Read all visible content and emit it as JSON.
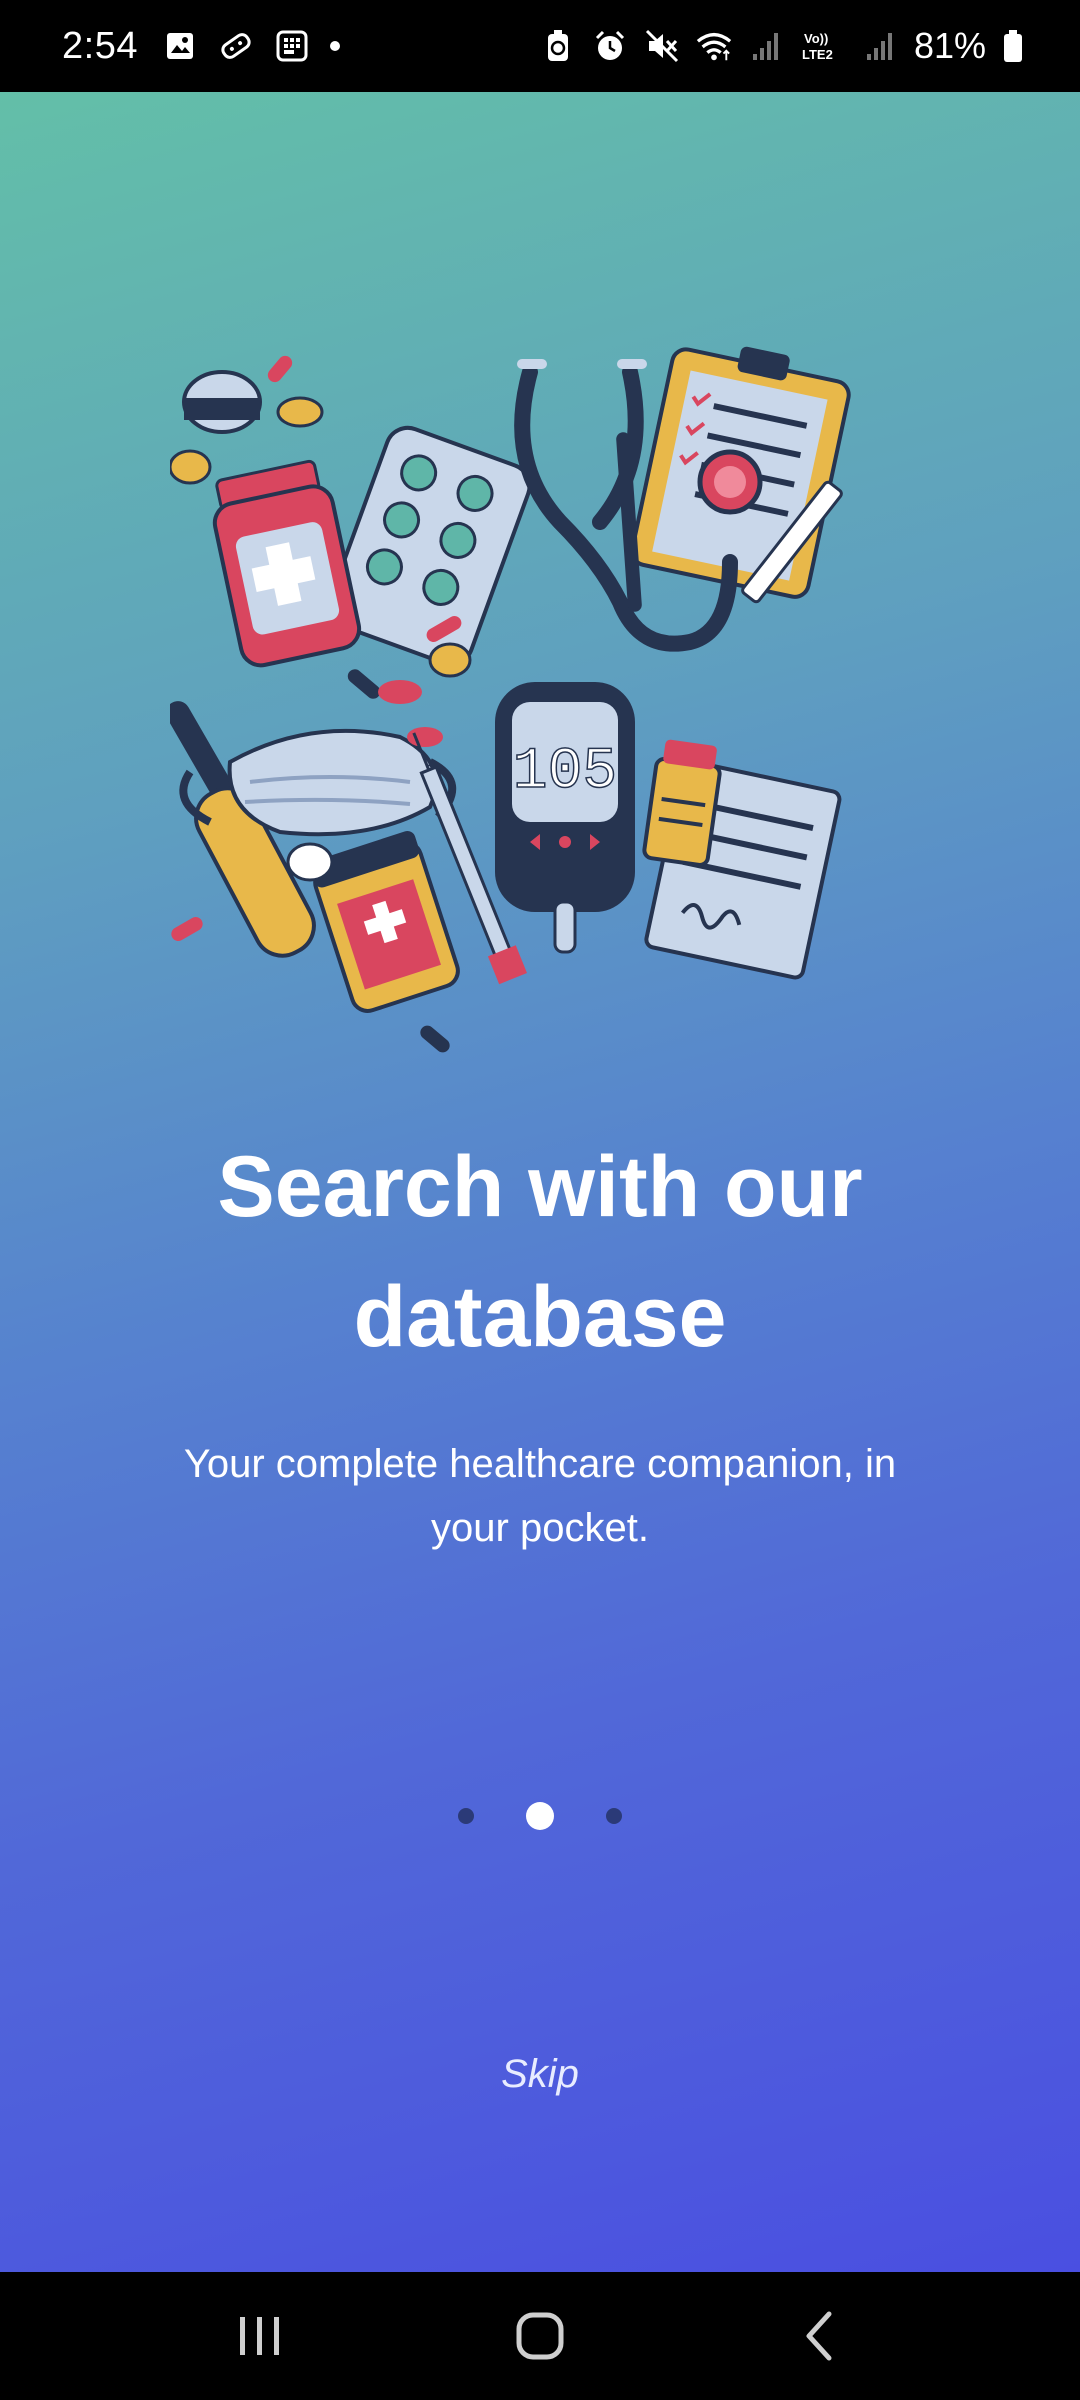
{
  "status_bar": {
    "time": "2:54",
    "battery": "81%",
    "left_icons": [
      "gallery-icon",
      "game-icon",
      "calculator-icon",
      "notification-dot"
    ],
    "right_icons": [
      "battery-saver-icon",
      "alarm-icon",
      "mute-icon",
      "wifi-icon",
      "signal-icon",
      "volte-icon",
      "signal-icon-2",
      "battery-icon"
    ]
  },
  "onboarding": {
    "title": "Search with our database",
    "subtitle": "Your complete healthcare companion, in your pocket.",
    "pages": 3,
    "active_page": 2,
    "skip_label": "Skip"
  },
  "nav": {
    "recents": "recents",
    "home": "home",
    "back": "back"
  },
  "colors": {
    "gradient_top": "#63bfa8",
    "gradient_bottom": "#4a4fe1",
    "red": "#d9465f",
    "yellow": "#e8b84a",
    "navy": "#263450",
    "light_blue": "#c9d7ea"
  }
}
